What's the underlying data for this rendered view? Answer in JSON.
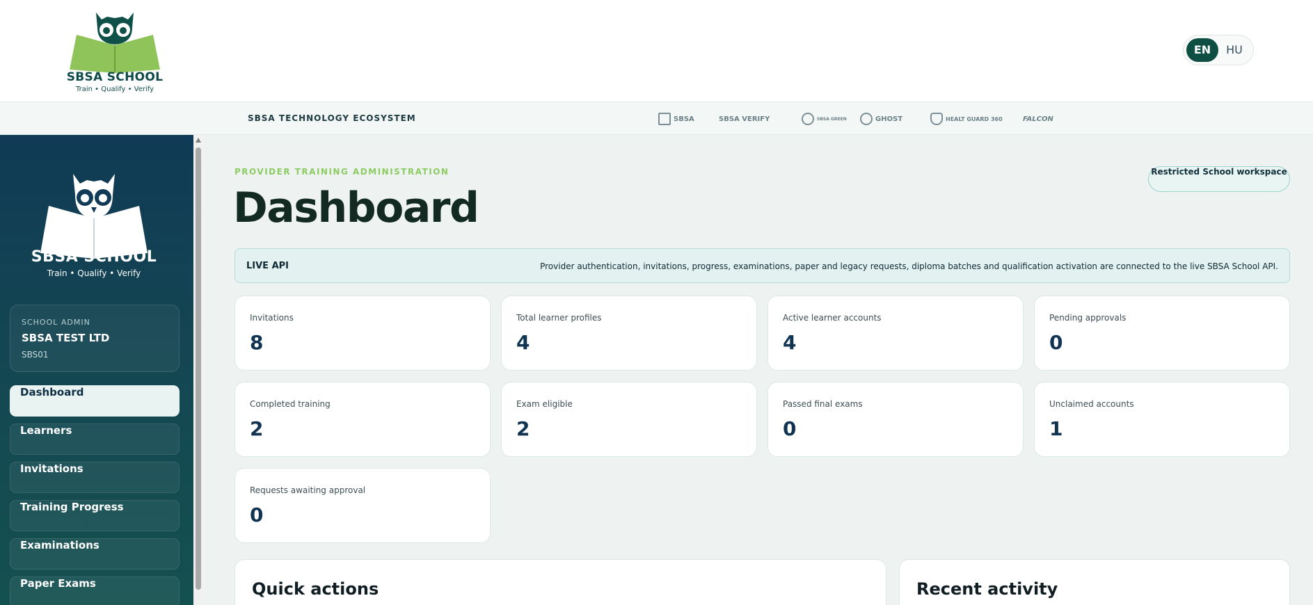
{
  "brand": {
    "name": "SBSA SCHOOL",
    "tagline": "Train • Qualify • Verify"
  },
  "language": {
    "options": [
      "EN",
      "HU"
    ],
    "selected": "EN"
  },
  "ecosystem": {
    "label": "SBSA TECHNOLOGY ECOSYSTEM",
    "logos": [
      {
        "name": "SBSA",
        "icon": "sbsa-logo"
      },
      {
        "name": "SBSA VERIFY",
        "icon": "sbsa-verify-logo"
      },
      {
        "name": "SBSA GREEN",
        "icon": "sbsa-green-logo"
      },
      {
        "name": "GHOST",
        "icon": "ghost-logo"
      },
      {
        "name": "HEALT GUARD 360",
        "icon": "healt-guard-logo"
      },
      {
        "name": "FALCON",
        "icon": "falcon-logo"
      }
    ]
  },
  "sidebar": {
    "admin": {
      "role": "SCHOOL ADMIN",
      "org": "SBSA TEST LTD",
      "code": "SBS01"
    },
    "items": [
      {
        "label": "Dashboard",
        "active": true
      },
      {
        "label": "Learners",
        "active": false
      },
      {
        "label": "Invitations",
        "active": false
      },
      {
        "label": "Training Progress",
        "active": false
      },
      {
        "label": "Examinations",
        "active": false
      },
      {
        "label": "Paper Exams",
        "active": false
      }
    ]
  },
  "main": {
    "eyebrow": "PROVIDER TRAINING ADMINISTRATION",
    "title": "Dashboard",
    "workspace_badge": "Restricted School workspace",
    "api": {
      "label": "LIVE API",
      "text": "Provider authentication, invitations, progress, examinations, paper and legacy requests, diploma batches and qualification activation are connected to the live SBSA School API."
    },
    "stats": [
      {
        "label": "Invitations",
        "value": "8"
      },
      {
        "label": "Total learner profiles",
        "value": "4"
      },
      {
        "label": "Active learner accounts",
        "value": "4"
      },
      {
        "label": "Pending approvals",
        "value": "0"
      },
      {
        "label": "Completed training",
        "value": "2"
      },
      {
        "label": "Exam eligible",
        "value": "2"
      },
      {
        "label": "Passed final exams",
        "value": "0"
      },
      {
        "label": "Unclaimed accounts",
        "value": "1"
      },
      {
        "label": "Requests awaiting approval",
        "value": "0"
      }
    ],
    "panels": {
      "quick_actions": "Quick actions",
      "recent_activity": "Recent activity"
    }
  },
  "colors": {
    "accent": "#0f4f43",
    "sidebar": "#103a55",
    "eyebrow": "#8ccc63",
    "stat_value": "#103452"
  }
}
